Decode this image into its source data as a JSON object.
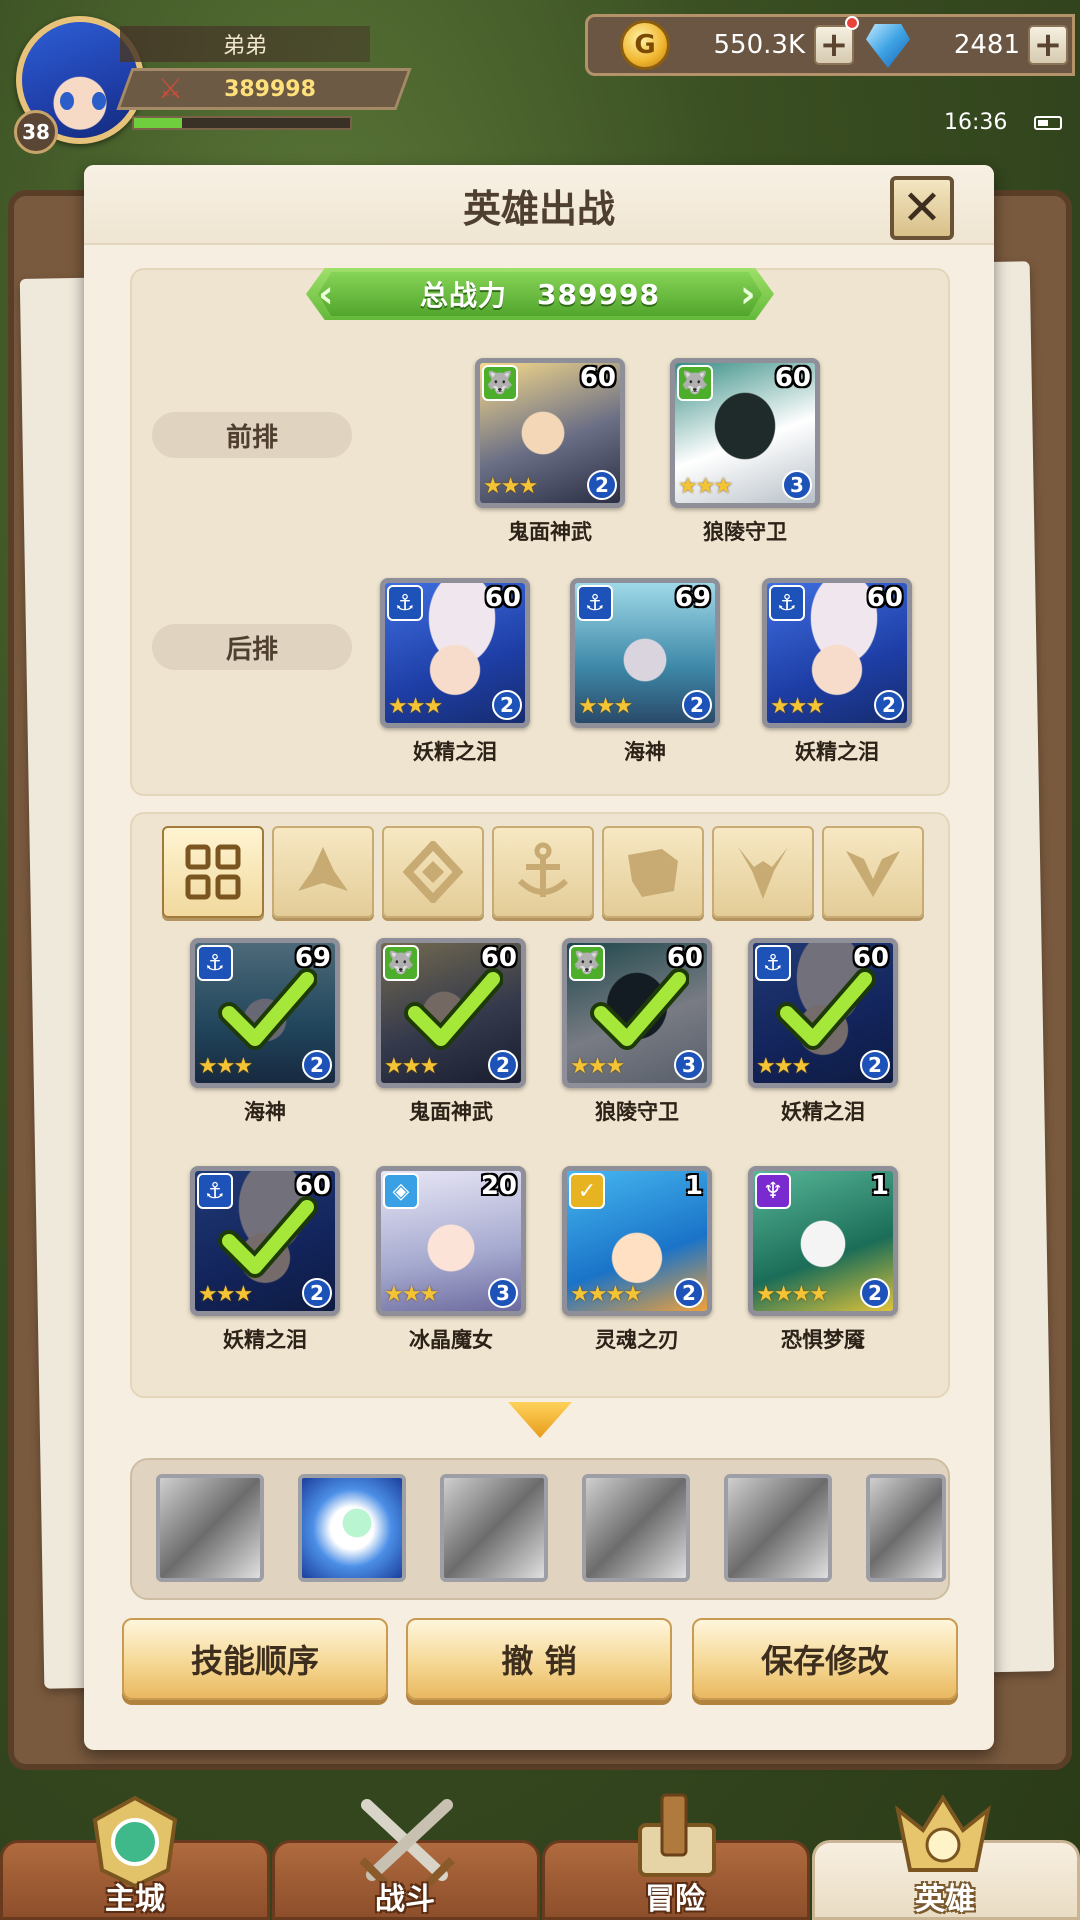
{
  "hud": {
    "player_name": "弟弟",
    "player_level": "38",
    "combat_power": "389998",
    "exp_progress": 0.22,
    "gold": "550.3K",
    "gems": "2481",
    "time": "16:36"
  },
  "panel": {
    "title": "英雄出战",
    "total_power_label": "总战力",
    "total_power_value": "389998",
    "front_row_label": "前排",
    "back_row_label": "后排"
  },
  "lineup": {
    "front": [
      {
        "name": "鬼面神武",
        "level": "60",
        "stars": 3,
        "star_badge": "2",
        "class": "beast"
      },
      {
        "name": "狼陵守卫",
        "level": "60",
        "stars": 3,
        "star_badge": "3",
        "class": "beast"
      }
    ],
    "back": [
      {
        "name": "妖精之泪",
        "level": "60",
        "stars": 3,
        "star_badge": "2",
        "class": "sea"
      },
      {
        "name": "海神",
        "level": "69",
        "stars": 3,
        "star_badge": "2",
        "class": "sea"
      },
      {
        "name": "妖精之泪",
        "level": "60",
        "stars": 3,
        "star_badge": "2",
        "class": "sea"
      }
    ]
  },
  "filter_tabs": [
    {
      "icon": "grid-icon",
      "active": true
    },
    {
      "icon": "leaf-crown-icon",
      "active": false
    },
    {
      "icon": "diamond-icon",
      "active": false
    },
    {
      "icon": "anchor-icon",
      "active": false
    },
    {
      "icon": "beast-head-icon",
      "active": false
    },
    {
      "icon": "horned-icon",
      "active": false
    },
    {
      "icon": "chevron-v-icon",
      "active": false
    }
  ],
  "roster": [
    {
      "name": "海神",
      "level": "69",
      "stars": 3,
      "star_badge": "2",
      "class": "sea",
      "selected": true
    },
    {
      "name": "鬼面神武",
      "level": "60",
      "stars": 3,
      "star_badge": "2",
      "class": "beast",
      "selected": true
    },
    {
      "name": "狼陵守卫",
      "level": "60",
      "stars": 3,
      "star_badge": "3",
      "class": "beast",
      "selected": true
    },
    {
      "name": "妖精之泪",
      "level": "60",
      "stars": 3,
      "star_badge": "2",
      "class": "sea",
      "selected": true
    },
    {
      "name": "妖精之泪",
      "level": "60",
      "stars": 3,
      "star_badge": "2",
      "class": "sea",
      "selected": true
    },
    {
      "name": "冰晶魔女",
      "level": "20",
      "stars": 3,
      "star_badge": "3",
      "class": "ice",
      "selected": false
    },
    {
      "name": "灵魂之刃",
      "level": "1",
      "stars": 4,
      "star_badge": "2",
      "class": "light",
      "selected": false
    },
    {
      "name": "恐惧梦魇",
      "level": "1",
      "stars": 4,
      "star_badge": "2",
      "class": "dark",
      "selected": false
    }
  ],
  "skills": [
    "skill-gray",
    "skill-blue",
    "skill-gray",
    "skill-gray",
    "skill-gray",
    "skill-gray"
  ],
  "actions": {
    "skill_order": "技能顺序",
    "undo": "撤 销",
    "save": "保存修改"
  },
  "nav": {
    "main_city": "主城",
    "battle": "战斗",
    "adventure": "冒险",
    "hero": "英雄",
    "active": "hero"
  },
  "colors": {
    "selected_check": "#8ed62a",
    "power_banner": "#64b93a",
    "gold_accent": "#f0b52e"
  }
}
